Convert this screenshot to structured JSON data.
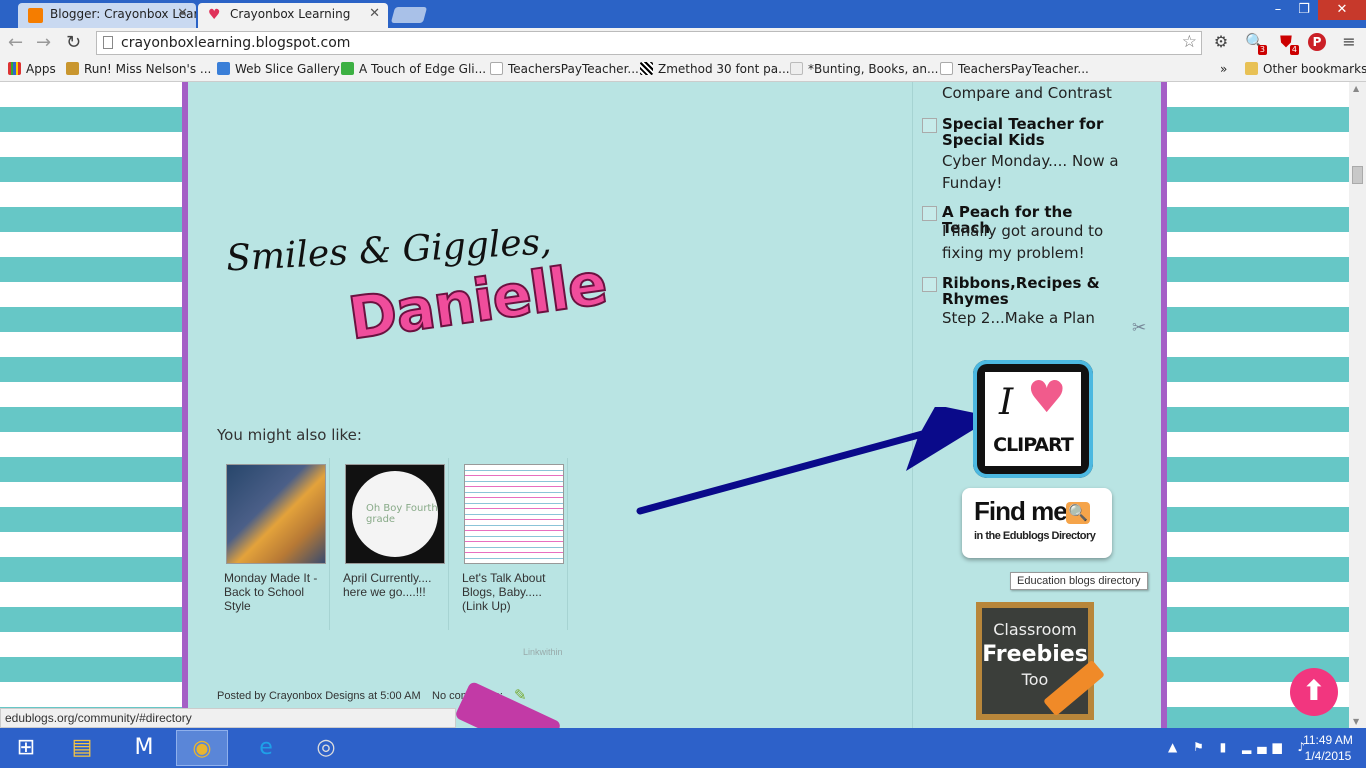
{
  "browser": {
    "tabs": [
      {
        "label": "Blogger: Crayonbox Learn",
        "icon": "blogger-icon",
        "color": "#f57d00"
      },
      {
        "label": "Crayonbox Learning",
        "icon": "heart-icon",
        "color": "#e0325a"
      }
    ],
    "window_controls": {
      "minimize": "–",
      "maximize": "❐",
      "close": "✕"
    },
    "url": "crayonboxlearning.blogspot.com",
    "extension_badges": {
      "zoom": "3",
      "shield": "4"
    },
    "bookmarks": [
      {
        "label": "Apps",
        "icon": "apps-grid-icon"
      },
      {
        "label": "Run! Miss Nelson's ...",
        "icon": "folder-photo-icon"
      },
      {
        "label": "Web Slice Gallery",
        "icon": "ie-webslice-icon"
      },
      {
        "label": "A Touch of Edge Gli...",
        "icon": "green-figure-icon"
      },
      {
        "label": "TeachersPayTeacher...",
        "icon": "tpt-apple-icon"
      },
      {
        "label": "Zmethod 30 font pa...",
        "icon": "zebra-icon"
      },
      {
        "label": "*Bunting, Books, an...",
        "icon": "bunting-icon"
      },
      {
        "label": "TeachersPayTeacher...",
        "icon": "tpt-apple-icon"
      }
    ],
    "bookmarks_more": "»",
    "other_bookmarks": "Other bookmarks"
  },
  "post": {
    "signature_line1": "Smiles & Giggles,",
    "signature_line2": "Danielle",
    "you_might_also_like": "You might also like:",
    "related": [
      {
        "caption": "Monday Made It - Back to School Style"
      },
      {
        "caption": "April Currently.... here we go....!!!"
      },
      {
        "caption": "Let's Talk About Blogs, Baby..... (Link Up)"
      }
    ],
    "related_thumb2_text": "Oh Boy Fourth grade",
    "linkwithin": "Linkwithin",
    "footer_posted": "Posted by Crayonbox Designs at 5:00 AM",
    "comments": "No comments:"
  },
  "sidebar": {
    "top_text": "Compare and Contrast",
    "blog_list": [
      {
        "name": "Special Teacher for Special Kids",
        "post": "Cyber Monday.... Now a Funday!"
      },
      {
        "name": "A Peach for the Teach",
        "post": "I finally got around to fixing my problem!"
      },
      {
        "name": "Ribbons,Recipes & Rhymes",
        "post": "Step 2...Make a Plan"
      }
    ],
    "clipart_badge": {
      "i": "I",
      "heart": "♥",
      "text": "CLIPART"
    },
    "findme_badge": {
      "title": "Find me",
      "subtitle": "in the Edublogs Directory"
    },
    "tooltip": "Education blogs directory",
    "freebies_badge": {
      "line1": "Classroom",
      "line2": "Freebies",
      "line3": "Too"
    }
  },
  "status_url": "edublogs.org/community/#directory",
  "taskbar": {
    "time": "11:49 AM",
    "date": "1/4/2015"
  },
  "colors": {
    "stripe_teal": "#66c7c6",
    "content_bg": "#b9e4e3",
    "border_purple": "#a45fc6",
    "arrow_navy": "#0a0a8a",
    "scrolltop_pink": "#f2367f"
  }
}
